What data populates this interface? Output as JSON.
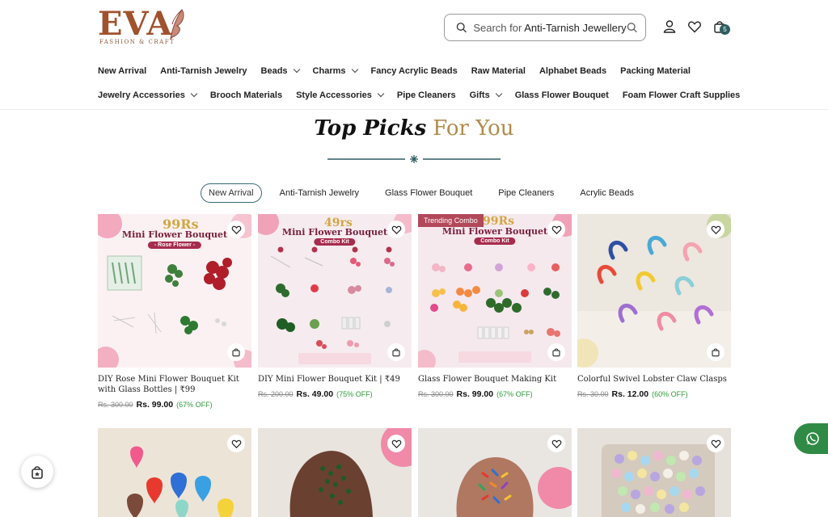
{
  "brand": {
    "name": "EVA",
    "tagline": "FASHION & CRAFT"
  },
  "search": {
    "prefix": "Search for ",
    "term": "Anti-Tarnish Jewellery"
  },
  "header_icons": [
    "search-icon",
    "user-icon",
    "heart-icon",
    "shopping-bag-icon"
  ],
  "cart_count": "5",
  "nav": {
    "row1": [
      {
        "label": "New Arrival",
        "dropdown": false
      },
      {
        "label": "Anti-Tarnish Jewelry",
        "dropdown": false
      },
      {
        "label": "Beads",
        "dropdown": true
      },
      {
        "label": "Charms",
        "dropdown": true
      },
      {
        "label": "Fancy Acrylic Beads",
        "dropdown": false
      },
      {
        "label": "Raw Material",
        "dropdown": false
      },
      {
        "label": "Alphabet Beads",
        "dropdown": false
      },
      {
        "label": "Packing Material",
        "dropdown": false
      }
    ],
    "row2": [
      {
        "label": "Jewelry Accessories",
        "dropdown": true
      },
      {
        "label": "Brooch Materials",
        "dropdown": false
      },
      {
        "label": "Style Accessories",
        "dropdown": true
      },
      {
        "label": "Pipe Cleaners",
        "dropdown": false
      },
      {
        "label": "Gifts",
        "dropdown": true
      },
      {
        "label": "Glass Flower Bouquet",
        "dropdown": false
      },
      {
        "label": "Foam Flower Craft Supplies",
        "dropdown": false
      }
    ]
  },
  "section": {
    "title_script": "Top Picks",
    "title_plain": "For You"
  },
  "tabs": [
    {
      "label": "New Arrival",
      "active": true
    },
    {
      "label": "Anti-Tarnish Jewelry",
      "active": false
    },
    {
      "label": "Glass Flower Bouquet",
      "active": false
    },
    {
      "label": "Pipe Cleaners",
      "active": false
    },
    {
      "label": "Acrylic Beads",
      "active": false
    }
  ],
  "products": [
    {
      "name": "DIY Rose Mini Flower Bouquet Kit with Glass Bottles | ₹99",
      "old_price": "Rs. 300.00",
      "price": "Rs. 99.00",
      "off": "(67% OFF)",
      "img": {
        "price_tag": "99Rs",
        "title": "Mini Flower Bouquet",
        "pill": "- Rose Flower -"
      }
    },
    {
      "name": "DIY Mini Flower Bouquet Kit | ₹49",
      "old_price": "Rs. 200.00",
      "price": "Rs. 49.00",
      "off": "(75% OFF)",
      "img": {
        "price_tag": "49rs",
        "title": "Mini Flower Bouquet",
        "pill": "Combo Kit"
      }
    },
    {
      "name": "Glass Flower Bouquet Making Kit",
      "old_price": "Rs. 300.00",
      "price": "Rs. 99.00",
      "off": "(67% OFF)",
      "badge": "Trending Combo",
      "img": {
        "price_tag": "99Rs",
        "title": "Mini Flower Bouquet",
        "pill": "Combo Kit"
      }
    },
    {
      "name": "Colorful Swivel Lobster Claw Clasps",
      "old_price": "Rs. 30.00",
      "price": "Rs. 12.00",
      "off": "(60% OFF)"
    }
  ],
  "colors": {
    "accent": "#2f5d62",
    "gold": "#b08c4a",
    "discount": "#2e9b3a",
    "whatsapp": "#2f8a46"
  }
}
